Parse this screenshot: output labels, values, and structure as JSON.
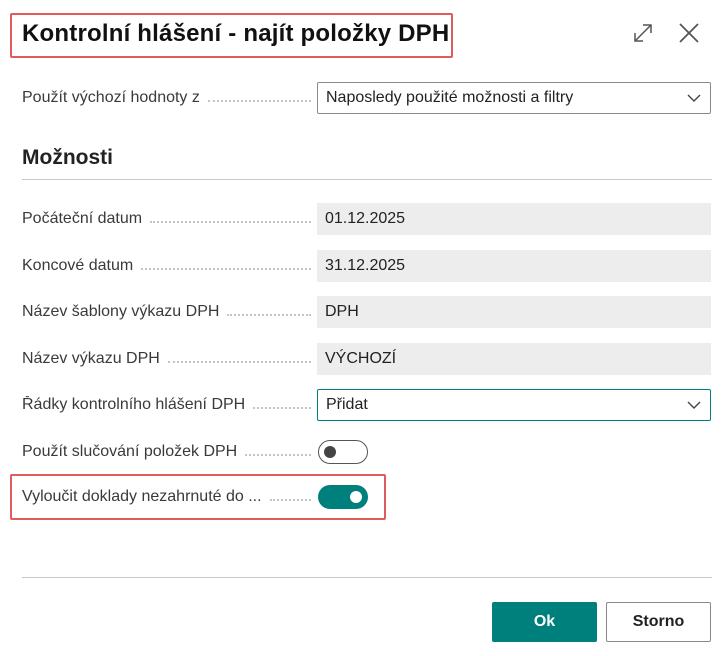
{
  "dialog": {
    "title": "Kontrolní hlášení - najít položky DPH"
  },
  "defaults": {
    "label": "Použít výchozí hodnoty z",
    "value": "Naposledy použité možnosti a filtry"
  },
  "section": {
    "title": "Možnosti"
  },
  "fields": {
    "start_date": {
      "label": "Počáteční datum",
      "value": "01.12.2025"
    },
    "end_date": {
      "label": "Koncové datum",
      "value": "31.12.2025"
    },
    "template_name": {
      "label": "Název šablony výkazu DPH",
      "value": "DPH"
    },
    "report_name": {
      "label": "Název výkazu DPH",
      "value": "VÝCHOZÍ"
    },
    "report_lines": {
      "label": "Řádky kontrolního hlášení DPH",
      "value": "Přidat"
    },
    "merge_entries": {
      "label": "Použít slučování položek DPH",
      "state": "off"
    },
    "exclude_docs": {
      "label": "Vyloučit doklady nezahrnuté do ...",
      "state": "on"
    }
  },
  "buttons": {
    "ok": "Ok",
    "cancel": "Storno"
  },
  "colors": {
    "accent": "#00807d",
    "highlight": "#e05a5e"
  }
}
